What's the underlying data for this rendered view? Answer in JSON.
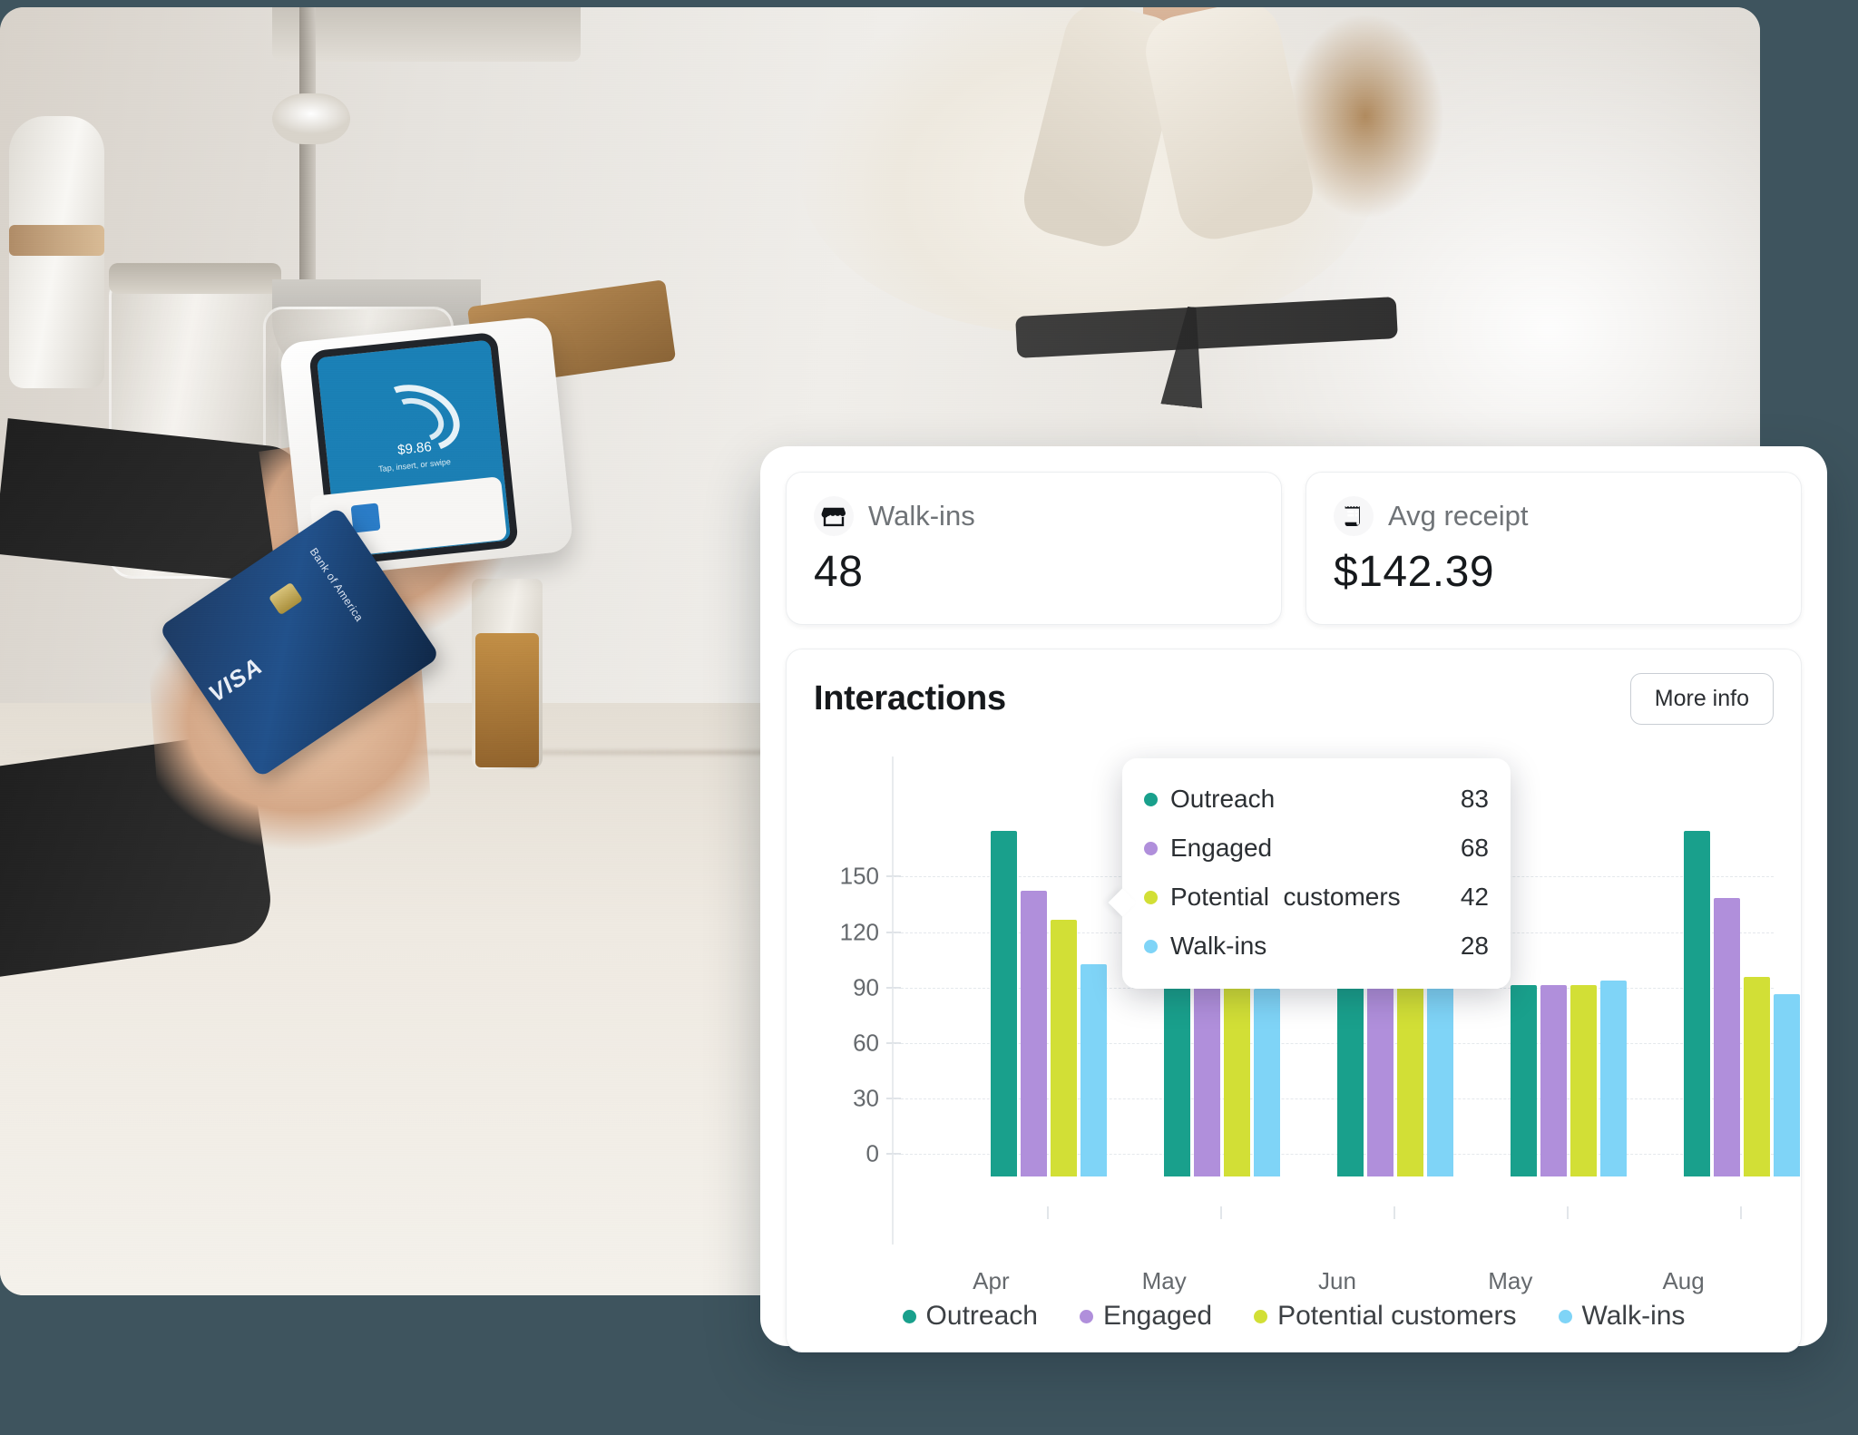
{
  "photo": {
    "terminal": {
      "amount": "$9.86",
      "hint": "Tap, insert, or swipe"
    },
    "card": {
      "network": "VISA",
      "bank": "Bank of America"
    }
  },
  "dashboard": {
    "stats": [
      {
        "icon": "storefront-icon",
        "label": "Walk-ins",
        "value": "48"
      },
      {
        "icon": "receipt-icon",
        "label": "Avg receipt",
        "value": "$142.39"
      }
    ],
    "chart_panel": {
      "title": "Interactions",
      "more_info_label": "More info"
    },
    "tooltip": {
      "rows": [
        {
          "label": "Outreach",
          "value": "83",
          "color": "#19a08c"
        },
        {
          "label": "Engaged",
          "value": "68",
          "color": "#b08fdb"
        },
        {
          "label": "Potential  customers",
          "value": "42",
          "color": "#d2df36"
        },
        {
          "label": "Walk-ins",
          "value": "28",
          "color": "#7fd4f7"
        }
      ]
    }
  },
  "chart_data": {
    "type": "bar",
    "title": "Interactions",
    "xlabel": "",
    "ylabel": "",
    "ylim": [
      0,
      150
    ],
    "yticks": [
      150,
      120,
      90,
      60,
      30,
      0
    ],
    "grid": true,
    "legend_position": "bottom",
    "categories": [
      "Apr",
      "May",
      "Jun",
      "May",
      "Aug"
    ],
    "series": [
      {
        "name": "Outreach",
        "color": "#19a08c",
        "values": [
          203,
          172,
          120,
          120,
          203
        ]
      },
      {
        "name": "Engaged",
        "color": "#b08fdb",
        "values": [
          171,
          170,
          120,
          120,
          167
        ]
      },
      {
        "name": "Potential customers",
        "color": "#d2df36",
        "values": [
          155,
          123,
          120,
          120,
          124
        ]
      },
      {
        "name": "Walk-ins",
        "color": "#7fd4f7",
        "values": [
          131,
          118,
          122,
          122,
          115
        ]
      }
    ],
    "bar_floor_value": 16,
    "annotations": {
      "tooltip_group": "May",
      "tooltip_values": {
        "Outreach": 83,
        "Engaged": 68,
        "Potential customers": 42,
        "Walk-ins": 28
      }
    }
  }
}
